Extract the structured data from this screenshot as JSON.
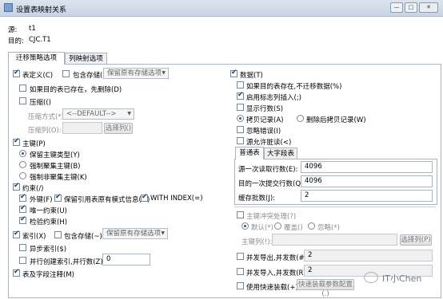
{
  "window": {
    "title": "设置表映射关系",
    "minimize": "—",
    "maximize": "□",
    "close": "✕"
  },
  "header": {
    "source_label": "源:",
    "source_value": "t1",
    "target_label": "目的:",
    "target_value": "CJC.T1"
  },
  "tabs": [
    "迁移策略选项",
    "列映射选项"
  ],
  "left": {
    "table_def": "表定义(C)",
    "include_storage": "包含存储(I)",
    "keep_storage_option": "保留原有存储选项",
    "drop_if_exists": "如果目的表已存在，先删除(D)",
    "compress": "压缩(()",
    "compress_mode_label": "压缩方式(*):",
    "compress_mode_value": "<--DEFAULT-->",
    "compress_cols_label": "压缩列(O):",
    "select_cols": "选择列()",
    "primary_key": "主键(P)",
    "pk_keep_type": "保留主键类型(Y)",
    "pk_force_clustered": "强制聚集主键(B)",
    "pk_force_nonclustered": "强制非聚集主键(K)",
    "constraints": "约束(/)",
    "fk": "外键(F)",
    "keep_ref_info": "保留引用表原有模式信息(>)",
    "with_index": "WITH INDEX(=)",
    "unique": "唯一约束(U)",
    "check": "检验约束(H)",
    "index": "索引(X)",
    "index_include_storage": "包含存储(~)",
    "index_keep_storage": "保留原有存储选项",
    "async_index": "异步索引($)",
    "parallel_index": "并行创建索引,并行数(Z):",
    "parallel_index_value": "0",
    "comments": "表及字段注释(M)"
  },
  "right": {
    "data": "数据(T)",
    "no_migrate_if_exists": "如果目的表存在,不迁移数据(%)",
    "enable_identity_insert": "启用标志列插入(;)",
    "show_row_count": "显示行数(S)",
    "copy_records": "拷贝记录(A)",
    "delete_then_copy": "删除后拷贝记录(W)",
    "ignore_errors": "忽略错误(I)",
    "allow_dirty_read": "源允许脏读(<)",
    "subtabs": [
      "普通表",
      "大字段表"
    ],
    "read_rows_label": "源一次读取行数(E):",
    "read_rows_value": "4096",
    "commit_rows_label": "目的一次提交行数(Q):",
    "commit_rows_value": "4096",
    "batch_label": "缓存批数(J):",
    "batch_value": "2",
    "pk_conflict": "主键冲突处理(?)",
    "pk_default": "默认(*)",
    "pk_overwrite": "覆盖()",
    "pk_ignore": "忽略(*)",
    "pk_cols_label": "主键列(!):",
    "pk_select_cols": "选择列(P)",
    "parallel_export_label": "并发导出,并发数(#):",
    "parallel_export_value": "2",
    "parallel_import_label": "并发导入,并发数(R):",
    "parallel_import_value": "2",
    "fast_load": "使用快速装载(+)",
    "fast_load_config": "快速装载参数配置(.)"
  },
  "watermark": "IT小Chen"
}
